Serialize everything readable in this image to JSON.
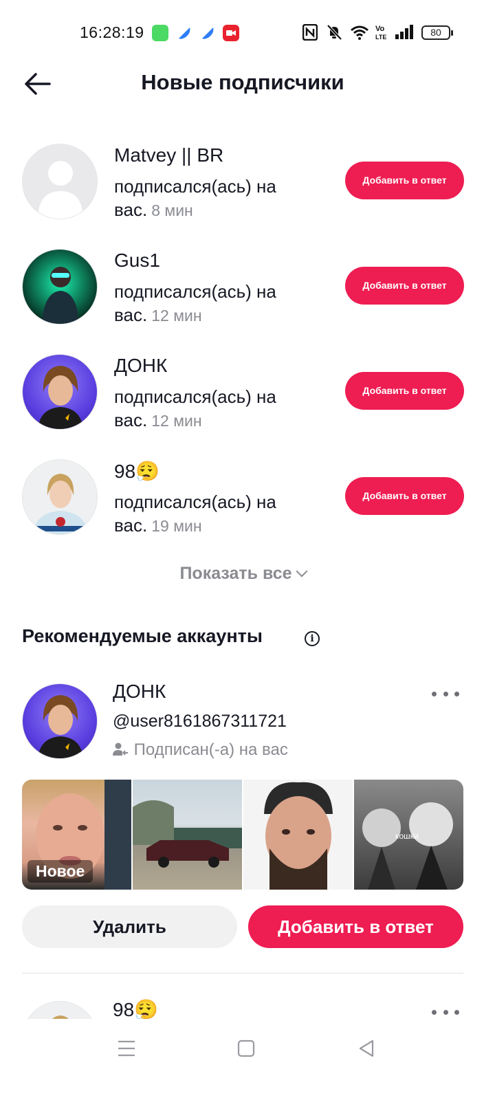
{
  "status_bar": {
    "time": "16:28:19",
    "battery": "80"
  },
  "header": {
    "title": "Новые подписчики"
  },
  "followers": [
    {
      "name": "Matvey || BR",
      "line1": "подписался(ась) на",
      "line2": "вас.",
      "time": "8 мин",
      "button": "Добавить в ответ",
      "avatar": "default-avatar"
    },
    {
      "name": "Gus1",
      "line1": "подписался(ась) на",
      "line2": "вас.",
      "time": "12 мин",
      "button": "Добавить в ответ",
      "avatar": "green-neon-avatar"
    },
    {
      "name": "ДОНК",
      "line1": "подписался(ась) на",
      "line2": "вас.",
      "time": "12 мин",
      "button": "Добавить в ответ",
      "avatar": "purple-portrait-avatar"
    },
    {
      "name": "98😮‍💨",
      "line1": "подписался(ась) на",
      "line2": "вас.",
      "time": "19 мин",
      "button": "Добавить в ответ",
      "avatar": "hockey-portrait-avatar"
    }
  ],
  "show_all": "Показать все",
  "recommended": {
    "title": "Рекомендуемые аккаунты",
    "account": {
      "name": "ДОНК",
      "handle": "@user8161867311721",
      "status": "Подписан(-а) на вас",
      "new_badge": "Новое",
      "thumb_caption": "кошки",
      "remove_label": "Удалить",
      "add_label": "Добавить в ответ"
    },
    "next_account": {
      "name": "98😮‍💨"
    }
  },
  "colors": {
    "accent": "#ee1d52",
    "text": "#161823",
    "muted": "#8a8b91",
    "secondary_button": "#f1f1f2"
  }
}
